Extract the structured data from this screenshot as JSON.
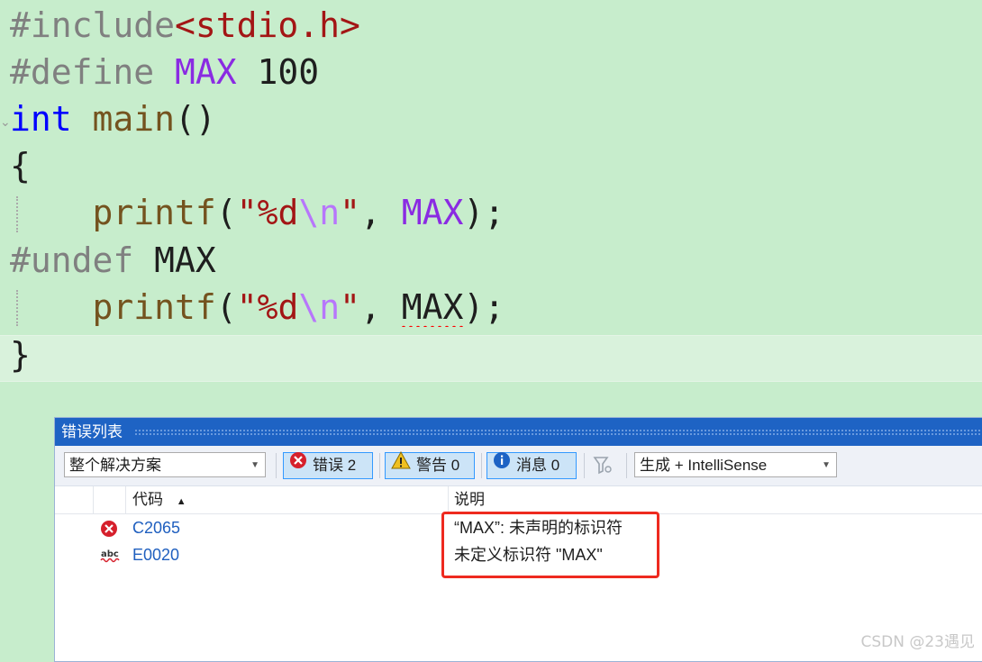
{
  "editor": {
    "lines": [
      {
        "tokens": [
          {
            "t": "#include",
            "c": "pp"
          },
          {
            "t": "<stdio.h>",
            "c": "inc"
          }
        ]
      },
      {
        "tokens": [
          {
            "t": "#define ",
            "c": "pp"
          },
          {
            "t": "MAX",
            "c": "macro"
          },
          {
            "t": " 100",
            "c": "num"
          }
        ]
      },
      {
        "tokens": [
          {
            "t": "int",
            "c": "kw"
          },
          {
            "t": " ",
            "c": "plain"
          },
          {
            "t": "main",
            "c": "fn"
          },
          {
            "t": "()",
            "c": "plain"
          }
        ]
      },
      {
        "tokens": [
          {
            "t": "{",
            "c": "plain"
          }
        ]
      },
      {
        "tokens": [
          {
            "t": "    ",
            "c": "plain"
          },
          {
            "t": "printf",
            "c": "fn"
          },
          {
            "t": "(",
            "c": "plain"
          },
          {
            "t": "\"%d",
            "c": "str"
          },
          {
            "t": "\\n",
            "c": "esc"
          },
          {
            "t": "\"",
            "c": "str"
          },
          {
            "t": ", ",
            "c": "plain"
          },
          {
            "t": "MAX",
            "c": "macro"
          },
          {
            "t": ");",
            "c": "plain"
          }
        ]
      },
      {
        "tokens": [
          {
            "t": "#undef",
            "c": "pp"
          },
          {
            "t": " MAX",
            "c": "plain"
          }
        ]
      },
      {
        "tokens": [
          {
            "t": "    ",
            "c": "plain"
          },
          {
            "t": "printf",
            "c": "fn"
          },
          {
            "t": "(",
            "c": "plain"
          },
          {
            "t": "\"%d",
            "c": "str"
          },
          {
            "t": "\\n",
            "c": "esc"
          },
          {
            "t": "\"",
            "c": "str"
          },
          {
            "t": ", ",
            "c": "plain"
          },
          {
            "t": "MAX",
            "c": "plain",
            "squiggle": true
          },
          {
            "t": ");",
            "c": "plain"
          }
        ]
      },
      {
        "tokens": [
          {
            "t": "}",
            "c": "plain"
          }
        ]
      }
    ]
  },
  "error_list": {
    "title": "错误列表",
    "scope_dropdown": "整个解决方案",
    "errors_button": "错误 2",
    "warnings_button": "警告 0",
    "messages_button": "消息 0",
    "source_dropdown": "生成 + IntelliSense",
    "columns": {
      "code": "代码",
      "description": "说明"
    },
    "rows": [
      {
        "icon": "error-icon",
        "code": "C2065",
        "description": "“MAX”: 未声明的标识符"
      },
      {
        "icon": "intellisense-abc-icon",
        "code": "E0020",
        "description": "未定义标识符 \"MAX\""
      }
    ]
  },
  "colors": {
    "error": "#d6202c",
    "warning": "#f0c020",
    "info": "#1e63c4",
    "highlight": "#ee2a1f"
  },
  "watermark": "CSDN @23遇见"
}
